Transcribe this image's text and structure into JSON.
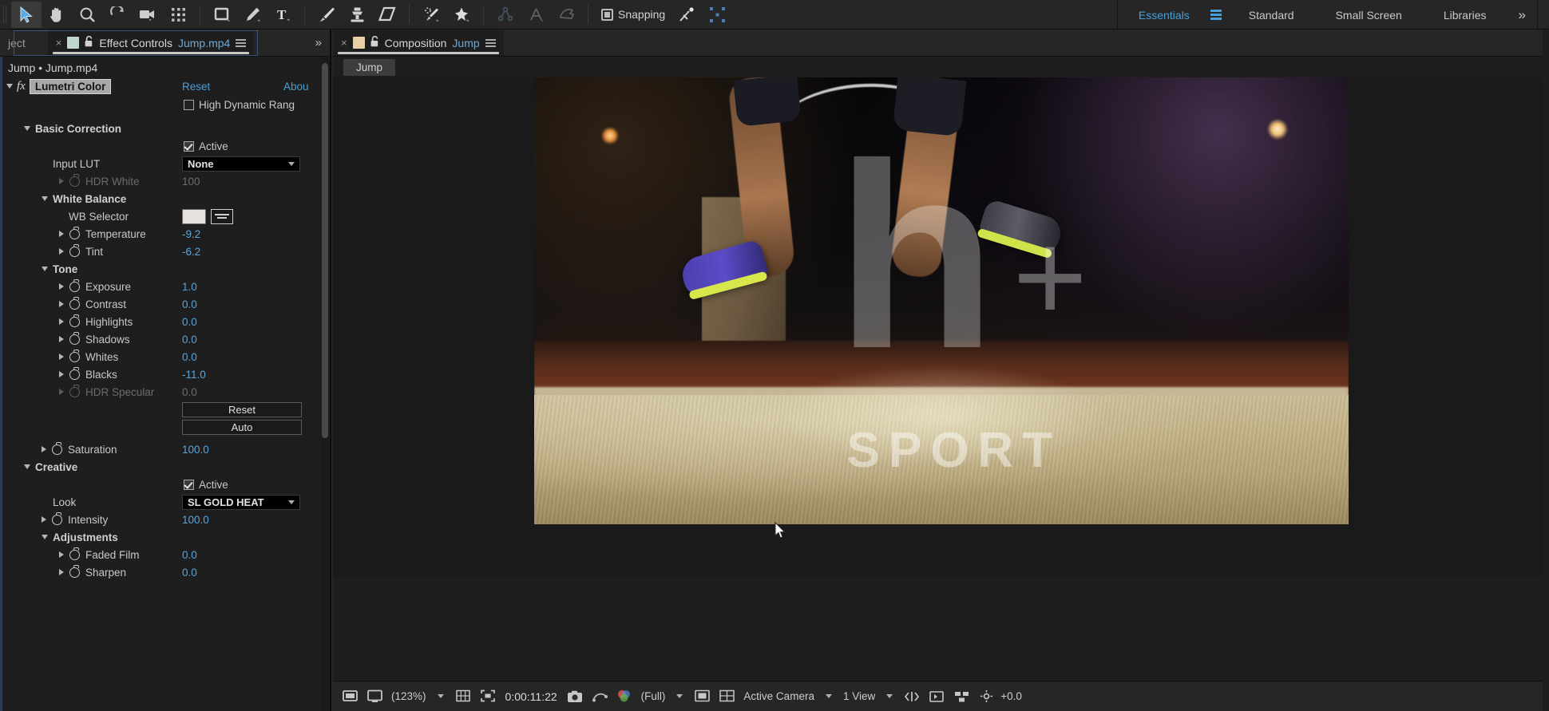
{
  "toolbar": {
    "tools": [
      {
        "name": "selection-tool",
        "label": "Selection Tool",
        "selected": true
      },
      {
        "name": "hand-tool",
        "label": "Hand Tool",
        "selected": false
      },
      {
        "name": "zoom-tool",
        "label": "Zoom Tool",
        "selected": false
      },
      {
        "name": "rotation-tool",
        "label": "Rotation Tool",
        "selected": false
      },
      {
        "name": "camera-tool",
        "label": "Unified Camera Tool",
        "selected": false
      },
      {
        "name": "pan-behind-tool",
        "label": "Pan Behind Tool",
        "selected": false
      },
      {
        "name": "shape-tool",
        "label": "Rectangle Tool",
        "selected": false
      },
      {
        "name": "pen-tool",
        "label": "Pen Tool",
        "selected": false
      },
      {
        "name": "type-tool",
        "label": "Type Tool",
        "selected": false
      },
      {
        "name": "brush-tool",
        "label": "Brush Tool",
        "selected": false
      },
      {
        "name": "clone-stamp-tool",
        "label": "Clone Stamp Tool",
        "selected": false
      },
      {
        "name": "eraser-tool",
        "label": "Eraser Tool",
        "selected": false
      },
      {
        "name": "roto-brush-tool",
        "label": "Roto Brush Tool",
        "selected": false
      },
      {
        "name": "puppet-pin-tool",
        "label": "Puppet Pin Tool",
        "selected": false
      }
    ],
    "snapping_label": "Snapping",
    "snapping_enabled": true,
    "workspaces": [
      {
        "label": "Essentials",
        "active": true
      },
      {
        "label": "Standard",
        "active": false
      },
      {
        "label": "Small Screen",
        "active": false
      },
      {
        "label": "Libraries",
        "active": false
      }
    ],
    "overflow_label": "»"
  },
  "left_panel": {
    "tabs": [
      {
        "label": "ject",
        "type": "project",
        "active": false
      },
      {
        "label": "Effect Controls ",
        "file": "Jump.mp4",
        "active": true,
        "close_label": "×"
      }
    ],
    "overflow_label": "»",
    "breadcrumb": "Jump • Jump.mp4",
    "effect": {
      "name": "Lumetri Color",
      "reset_label": "Reset",
      "about_label": "Abou",
      "hdr_checkbox_label": "High Dynamic Rang",
      "hdr_checked": false
    },
    "sections": [
      {
        "name": "Basic Correction",
        "expanded": true,
        "active_label": "Active",
        "active_checked": true,
        "rows": [
          {
            "type": "dropdown",
            "label": "Input LUT",
            "value": "None",
            "indent": 1
          },
          {
            "type": "param",
            "label": "HDR White",
            "value": "100",
            "indent": 2,
            "dim": true
          },
          {
            "type": "subheader",
            "label": "White Balance",
            "indent": 1
          },
          {
            "type": "wb",
            "label": "WB Selector",
            "indent": 2
          },
          {
            "type": "param",
            "label": "Temperature",
            "value": "-9.2",
            "indent": 2,
            "dim": false
          },
          {
            "type": "param",
            "label": "Tint",
            "value": "-6.2",
            "indent": 2,
            "dim": false
          },
          {
            "type": "subheader",
            "label": "Tone",
            "indent": 1
          },
          {
            "type": "param",
            "label": "Exposure",
            "value": "1.0",
            "indent": 2,
            "dim": false
          },
          {
            "type": "param",
            "label": "Contrast",
            "value": "0.0",
            "indent": 2,
            "dim": false
          },
          {
            "type": "param",
            "label": "Highlights",
            "value": "0.0",
            "indent": 2,
            "dim": false
          },
          {
            "type": "param",
            "label": "Shadows",
            "value": "0.0",
            "indent": 2,
            "dim": false
          },
          {
            "type": "param",
            "label": "Whites",
            "value": "0.0",
            "indent": 2,
            "dim": false
          },
          {
            "type": "param",
            "label": "Blacks",
            "value": "-11.0",
            "indent": 2,
            "dim": false
          },
          {
            "type": "param",
            "label": "HDR Specular",
            "value": "0.0",
            "indent": 2,
            "dim": true
          },
          {
            "type": "button",
            "label": "Reset"
          },
          {
            "type": "button",
            "label": "Auto"
          },
          {
            "type": "param",
            "label": "Saturation",
            "value": "100.0",
            "indent": 1,
            "dim": false
          }
        ]
      },
      {
        "name": "Creative",
        "expanded": true,
        "active_label": "Active",
        "active_checked": true,
        "rows": [
          {
            "type": "dropdown",
            "label": "Look",
            "value": "SL GOLD HEAT",
            "indent": 1
          },
          {
            "type": "param",
            "label": "Intensity",
            "value": "100.0",
            "indent": 1,
            "dim": false
          },
          {
            "type": "subheader",
            "label": "Adjustments",
            "indent": 1
          },
          {
            "type": "param",
            "label": "Faded Film",
            "value": "0.0",
            "indent": 2,
            "dim": false
          },
          {
            "type": "param",
            "label": "Sharpen",
            "value": "0.0",
            "indent": 2,
            "dim": false
          }
        ]
      }
    ]
  },
  "comp_panel": {
    "tabs": [
      {
        "label": "Composition ",
        "name": "Jump",
        "active": true,
        "close_label": "×"
      }
    ],
    "breadcrumb_chip": "Jump",
    "artwork": {
      "logo_letter": "h",
      "logo_plus": "+",
      "logo_word": "SPORT"
    },
    "bottom_bar": {
      "zoom": "(123%)",
      "timecode": "0:00:11:22",
      "resolution": "(Full)",
      "camera": "Active Camera",
      "views": "1 View",
      "exposure": "+0.0"
    }
  },
  "colors": {
    "accent_blue": "#4a9fd8",
    "value_blue": "#5aa5d8",
    "panel_bg": "#1e1e1e",
    "toolbar_bg": "#262626"
  }
}
